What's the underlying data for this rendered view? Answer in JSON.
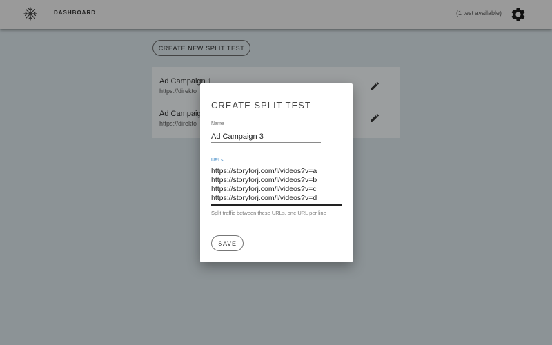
{
  "appbar": {
    "logo_icon": "snowflake-logo-icon",
    "nav_label": "DASHBOARD",
    "tests_available": "(1 test available)",
    "settings_icon": "gear-icon"
  },
  "main": {
    "new_test_button": "CREATE NEW SPLIT TEST",
    "campaigns": [
      {
        "title": "Ad Campaign 1",
        "url": "https://direkto",
        "edit_icon": "pencil-icon"
      },
      {
        "title": "Ad Campaig",
        "url": "https://direkto",
        "edit_icon": "pencil-icon"
      }
    ]
  },
  "dialog": {
    "title": "CREATE SPLIT TEST",
    "name_label": "Name",
    "name_value": "Ad Campaign 3",
    "urls_label": "URLs",
    "urls_value": "https://storyforj.com/l/videos?v=a\nhttps://storyforj.com/l/videos?v=b\nhttps://storyforj.com/l/videos?v=c\nhttps://storyforj.com/l/videos?v=d",
    "urls_helper": "Split traffic between these URLs, one URL per line",
    "save_button": "SAVE"
  },
  "colors": {
    "backdrop": "#8c9396",
    "appbar": "#9a9a9a",
    "accent": "#2f7fc1",
    "dialog_bg": "#ffffff"
  }
}
